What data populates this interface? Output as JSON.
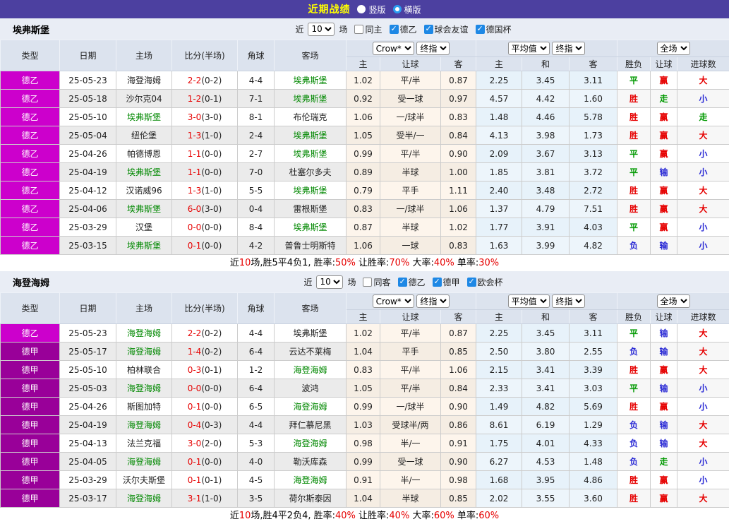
{
  "colors": {
    "title_bg": "#4c40a0",
    "title_text": "#ffff00",
    "checkbox_blue": "#1e88e5",
    "radio_blue": "#2b9df0",
    "team_green": "#008800",
    "score_red": "#e60000",
    "league": {
      "德乙": "#cc00cc",
      "德甲": "#990099"
    },
    "result": {
      "胜": "#e60000",
      "平": "#009900",
      "负": "#2b2bd5",
      "赢": "#e60000",
      "输": "#2b2bd5",
      "走": "#009900",
      "大": "#e60000",
      "小": "#2b2bd5"
    }
  },
  "titlebar": {
    "title": "近期战绩",
    "options": [
      {
        "label": "竖版",
        "selected": false
      },
      {
        "label": "横版",
        "selected": true
      }
    ]
  },
  "columns": {
    "type": "类型",
    "date": "日期",
    "home": "主场",
    "score": "比分(半场)",
    "corner": "角球",
    "away": "客场",
    "crow": "Crow*",
    "crow_final": "终指",
    "avg": "平均值",
    "avg_final": "终指",
    "full": "全场",
    "odds_home": "主",
    "odds_handicap": "让球",
    "odds_away": "客",
    "avg_home": "主",
    "avg_draw": "和",
    "avg_away": "客",
    "wl": "胜负",
    "handicap_result": "让球",
    "goals_result": "进球数"
  },
  "row_fields": [
    "league",
    "date",
    "home",
    "score(halftime)",
    "corners",
    "away",
    "crow_home",
    "handicap",
    "crow_away",
    "avg_home",
    "avg_draw",
    "avg_away",
    "result_winlose",
    "result_handicap",
    "result_goals"
  ],
  "tables": [
    {
      "team": "埃弗斯堡",
      "near_label": "近",
      "matches_count": "10",
      "matches_label": "场",
      "filters": [
        {
          "label": "同主",
          "checked": false
        },
        {
          "label": "德乙",
          "checked": true
        },
        {
          "label": "球会友谊",
          "checked": true
        },
        {
          "label": "德国杯",
          "checked": true
        }
      ],
      "rows": [
        [
          "德乙",
          "25-05-23",
          "海登海姆",
          "2-2(0-2)",
          "4-4",
          "埃弗斯堡",
          "1.02",
          "平/半",
          "0.87",
          "2.25",
          "3.45",
          "3.11",
          "平",
          "赢",
          "大"
        ],
        [
          "德乙",
          "25-05-18",
          "沙尔克04",
          "1-2(0-1)",
          "7-1",
          "埃弗斯堡",
          "0.92",
          "受一球",
          "0.97",
          "4.57",
          "4.42",
          "1.60",
          "胜",
          "走",
          "小"
        ],
        [
          "德乙",
          "25-05-10",
          "埃弗斯堡",
          "3-0(3-0)",
          "8-1",
          "布伦瑞克",
          "1.06",
          "一/球半",
          "0.83",
          "1.48",
          "4.46",
          "5.78",
          "胜",
          "赢",
          "走"
        ],
        [
          "德乙",
          "25-05-04",
          "纽伦堡",
          "1-3(1-0)",
          "2-4",
          "埃弗斯堡",
          "1.05",
          "受半/一",
          "0.84",
          "4.13",
          "3.98",
          "1.73",
          "胜",
          "赢",
          "大"
        ],
        [
          "德乙",
          "25-04-26",
          "帕德博恩",
          "1-1(0-0)",
          "2-7",
          "埃弗斯堡",
          "0.99",
          "平/半",
          "0.90",
          "2.09",
          "3.67",
          "3.13",
          "平",
          "赢",
          "小"
        ],
        [
          "德乙",
          "25-04-19",
          "埃弗斯堡",
          "1-1(0-0)",
          "7-0",
          "杜塞尔多夫",
          "0.89",
          "半球",
          "1.00",
          "1.85",
          "3.81",
          "3.72",
          "平",
          "输",
          "小"
        ],
        [
          "德乙",
          "25-04-12",
          "汉诺威96",
          "1-3(1-0)",
          "5-5",
          "埃弗斯堡",
          "0.79",
          "平手",
          "1.11",
          "2.40",
          "3.48",
          "2.72",
          "胜",
          "赢",
          "大"
        ],
        [
          "德乙",
          "25-04-06",
          "埃弗斯堡",
          "6-0(3-0)",
          "0-4",
          "雷根斯堡",
          "0.83",
          "一/球半",
          "1.06",
          "1.37",
          "4.79",
          "7.51",
          "胜",
          "赢",
          "大"
        ],
        [
          "德乙",
          "25-03-29",
          "汉堡",
          "0-0(0-0)",
          "8-4",
          "埃弗斯堡",
          "0.87",
          "半球",
          "1.02",
          "1.77",
          "3.91",
          "4.03",
          "平",
          "赢",
          "小"
        ],
        [
          "德乙",
          "25-03-15",
          "埃弗斯堡",
          "0-1(0-0)",
          "4-2",
          "普鲁士明斯特",
          "1.06",
          "一球",
          "0.83",
          "1.63",
          "3.99",
          "4.82",
          "负",
          "输",
          "小"
        ]
      ],
      "summary": [
        [
          "近",
          "black"
        ],
        [
          "10",
          "red"
        ],
        [
          "场,胜5平4负1, 胜率:",
          "black"
        ],
        [
          "50%",
          "red"
        ],
        [
          " 让胜率:",
          "black"
        ],
        [
          "70%",
          "red"
        ],
        [
          " 大率:",
          "black"
        ],
        [
          "40%",
          "red"
        ],
        [
          " 单率:",
          "black"
        ],
        [
          "30%",
          "red"
        ]
      ]
    },
    {
      "team": "海登海姆",
      "near_label": "近",
      "matches_count": "10",
      "matches_label": "场",
      "filters": [
        {
          "label": "同客",
          "checked": false
        },
        {
          "label": "德乙",
          "checked": true
        },
        {
          "label": "德甲",
          "checked": true
        },
        {
          "label": "欧会杯",
          "checked": true
        }
      ],
      "rows": [
        [
          "德乙",
          "25-05-23",
          "海登海姆",
          "2-2(0-2)",
          "4-4",
          "埃弗斯堡",
          "1.02",
          "平/半",
          "0.87",
          "2.25",
          "3.45",
          "3.11",
          "平",
          "输",
          "大"
        ],
        [
          "德甲",
          "25-05-17",
          "海登海姆",
          "1-4(0-2)",
          "6-4",
          "云达不莱梅",
          "1.04",
          "平手",
          "0.85",
          "2.50",
          "3.80",
          "2.55",
          "负",
          "输",
          "大"
        ],
        [
          "德甲",
          "25-05-10",
          "柏林联合",
          "0-3(0-1)",
          "1-2",
          "海登海姆",
          "0.83",
          "平/半",
          "1.06",
          "2.15",
          "3.41",
          "3.39",
          "胜",
          "赢",
          "大"
        ],
        [
          "德甲",
          "25-05-03",
          "海登海姆",
          "0-0(0-0)",
          "6-4",
          "波鸿",
          "1.05",
          "平/半",
          "0.84",
          "2.33",
          "3.41",
          "3.03",
          "平",
          "输",
          "小"
        ],
        [
          "德甲",
          "25-04-26",
          "斯图加特",
          "0-1(0-0)",
          "6-5",
          "海登海姆",
          "0.99",
          "一/球半",
          "0.90",
          "1.49",
          "4.82",
          "5.69",
          "胜",
          "赢",
          "小"
        ],
        [
          "德甲",
          "25-04-19",
          "海登海姆",
          "0-4(0-3)",
          "4-4",
          "拜仁慕尼黑",
          "1.03",
          "受球半/两",
          "0.86",
          "8.61",
          "6.19",
          "1.29",
          "负",
          "输",
          "大"
        ],
        [
          "德甲",
          "25-04-13",
          "法兰克福",
          "3-0(2-0)",
          "5-3",
          "海登海姆",
          "0.98",
          "半/一",
          "0.91",
          "1.75",
          "4.01",
          "4.33",
          "负",
          "输",
          "大"
        ],
        [
          "德甲",
          "25-04-05",
          "海登海姆",
          "0-1(0-0)",
          "4-0",
          "勒沃库森",
          "0.99",
          "受一球",
          "0.90",
          "6.27",
          "4.53",
          "1.48",
          "负",
          "走",
          "小"
        ],
        [
          "德甲",
          "25-03-29",
          "沃尔夫斯堡",
          "0-1(0-1)",
          "4-5",
          "海登海姆",
          "0.91",
          "半/一",
          "0.98",
          "1.68",
          "3.95",
          "4.86",
          "胜",
          "赢",
          "小"
        ],
        [
          "德甲",
          "25-03-17",
          "海登海姆",
          "3-1(1-0)",
          "3-5",
          "荷尔斯泰因",
          "1.04",
          "半球",
          "0.85",
          "2.02",
          "3.55",
          "3.60",
          "胜",
          "赢",
          "大"
        ]
      ],
      "summary": [
        [
          "近",
          "black"
        ],
        [
          "10",
          "red"
        ],
        [
          "场,胜4平2负4, 胜率:",
          "black"
        ],
        [
          "40%",
          "red"
        ],
        [
          " 让胜率:",
          "black"
        ],
        [
          "40%",
          "red"
        ],
        [
          " 大率:",
          "black"
        ],
        [
          "60%",
          "red"
        ],
        [
          " 单率:",
          "black"
        ],
        [
          "60%",
          "red"
        ]
      ]
    }
  ]
}
